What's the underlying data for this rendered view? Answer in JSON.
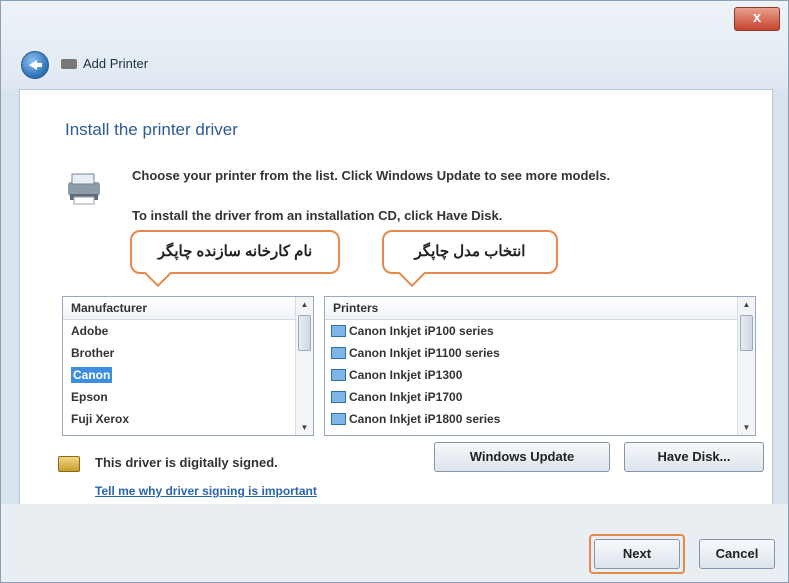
{
  "window": {
    "title": "Add Printer",
    "close_label": "x"
  },
  "page": {
    "heading": "Install the printer driver",
    "desc1": "Choose your printer from the list. Click Windows Update to see more models.",
    "desc2": "To install the driver from an installation CD, click Have Disk."
  },
  "callouts": {
    "manufacturer": "نام کارخانه سازنده چاپگر",
    "model": "انتخاب مدل چاپگر"
  },
  "manufacturers": {
    "header": "Manufacturer",
    "items": [
      "Adobe",
      "Brother",
      "Canon",
      "Epson",
      "Fuji Xerox"
    ],
    "selected": "Canon"
  },
  "printers": {
    "header": "Printers",
    "items": [
      "Canon Inkjet iP100 series",
      "Canon Inkjet iP1100 series",
      "Canon Inkjet iP1300",
      "Canon Inkjet iP1700",
      "Canon Inkjet iP1800 series"
    ]
  },
  "buttons": {
    "windows_update": "Windows Update",
    "have_disk": "Have Disk...",
    "next": "Next",
    "cancel": "Cancel"
  },
  "signing": {
    "status": "This driver is digitally signed.",
    "link": "Tell me why driver signing is important"
  },
  "colors": {
    "accent_outline": "#e58a4b",
    "selection": "#3d8ee0",
    "heading": "#2d5b96"
  }
}
